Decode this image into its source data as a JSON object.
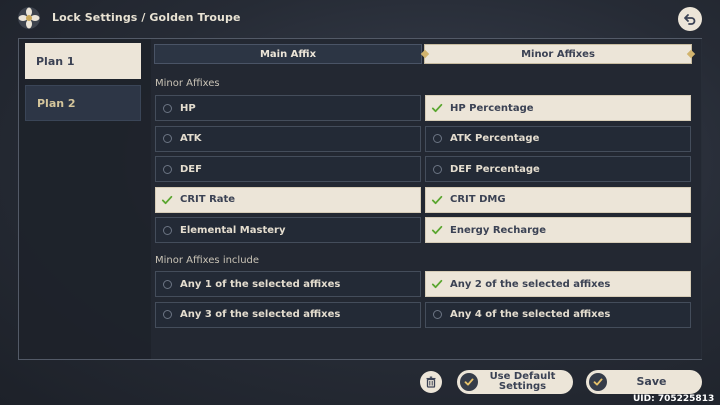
{
  "header": {
    "title": "Lock Settings / Golden Troupe",
    "logo_icon": "artifact-flower-icon",
    "back_icon": "back-arrow-icon"
  },
  "sidebar": {
    "plans": [
      {
        "label": "Plan 1",
        "active": true
      },
      {
        "label": "Plan 2",
        "active": false
      }
    ]
  },
  "tabs": [
    {
      "label": "Main Affix",
      "active": false
    },
    {
      "label": "Minor Affixes",
      "active": true
    }
  ],
  "minor_affixes": {
    "heading": "Minor Affixes",
    "options": [
      {
        "label": "HP",
        "checked": false
      },
      {
        "label": "HP Percentage",
        "checked": true
      },
      {
        "label": "ATK",
        "checked": false
      },
      {
        "label": "ATK Percentage",
        "checked": false
      },
      {
        "label": "DEF",
        "checked": false
      },
      {
        "label": "DEF Percentage",
        "checked": false
      },
      {
        "label": "CRIT Rate",
        "checked": true
      },
      {
        "label": "CRIT DMG",
        "checked": true
      },
      {
        "label": "Elemental Mastery",
        "checked": false
      },
      {
        "label": "Energy Recharge",
        "checked": true
      }
    ]
  },
  "include": {
    "heading": "Minor Affixes include",
    "options": [
      {
        "label": "Any 1 of the selected affixes",
        "checked": false
      },
      {
        "label": "Any 2 of the selected affixes",
        "checked": true
      },
      {
        "label": "Any 3 of the selected affixes",
        "checked": false
      },
      {
        "label": "Any 4 of the selected affixes",
        "checked": false
      }
    ]
  },
  "footer": {
    "default_label_line1": "Use Default",
    "default_label_line2": "Settings",
    "save_label": "Save",
    "uid": "UID: 705225813"
  },
  "colors": {
    "accent_check": "#5aa62f",
    "selected_bg": "#ece5d8",
    "unselected_bg": "#232a36",
    "label_gold": "#d4c59b"
  }
}
